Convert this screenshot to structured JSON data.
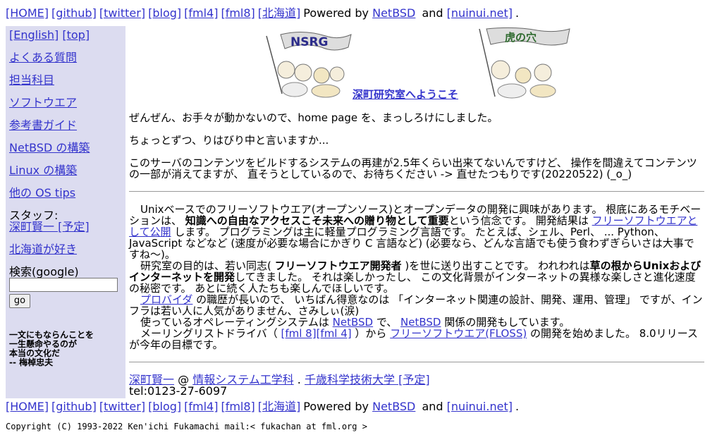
{
  "nav": {
    "home": "[HOME]",
    "github": "[github]",
    "twitter": "[twitter]",
    "blog": "[blog]",
    "fml4": "[fml4]",
    "fml8": "[fml8]",
    "hokkaido": "[北海道]",
    "powered_by": "Powered by",
    "netbsd": "NetBSD",
    "and": "and",
    "nuinui": "[nuinui.net]",
    "period": "."
  },
  "sidebar": {
    "english": "[English]",
    "top": "[top]",
    "faq": "よくある質問",
    "courses": "担当科目",
    "software": "ソフトウエア",
    "books": "参考書ガイド",
    "netbsd_build": "NetBSD の構築",
    "linux_build": "Linux の構築",
    "other_os": "他の OS tips",
    "staff_label": "スタッフ:",
    "staff_name": "深町賢一 [予定]",
    "hokkaido_love": "北海道が好き",
    "search_label": "検索(google)",
    "search_value": "",
    "go": "go",
    "motto": "一文にもならんことを\n一生懸命やるのが\n本当の文化だ\n-- 梅棹忠夫"
  },
  "main": {
    "banner_left_text": "NSRG",
    "banner_right_text": "虎の穴",
    "welcome": "深町研究室へようこそ",
    "para1": "ぜんぜん、お手々が動かないので、home page を、まっしろけにしました。",
    "para2": "ちょっとずつ、りはびり中と言いますか...",
    "para3": "このサーバのコンテンツをビルドするシステムの再建が2.5年くらい出来てないんですけど、 操作を間違えてコンテンツの一部が消えてますが、 直そうとしているので、お待ちください -> 直せたつもりです(20220522) (_o_)",
    "b1_a": "Unixベースでのフリーソフトウエア(オープンソース)とオープンデータの開発に興味があります。 根底にあるモチベーションは、 ",
    "b1_bold": "知識への自由なアクセスこそ未来への贈り物として重要",
    "b1_b": "という信念です。 開発結果は ",
    "b1_link": "フリーソフトウエアとして公開",
    "b1_c": " します。 プログラミングは主に軽量プログラミング言語です。 たとえば、シェル、Perl、 ... Python、 JavaScript などなど (速度が必要な場合にかぎり C 言語など) (必要なら、どんな言語でも使う食わずぎらいさは大事ですね〜)。",
    "b2_a": "研究室の目的は、若い同志( ",
    "b2_bold1": "フリーソフトウエア開発者",
    "b2_b": " )を世に送り出すことです。 われわれは",
    "b2_bold2": "草の根からUnixおよびインターネットを開発",
    "b2_c": "してきました。 それは楽しかったし、 この文化背景がインターネットの異様な楽しさと進化速度の秘密です。 あとに続く人たちも楽しんでほしいです。",
    "b3_link": "プロバイダ",
    "b3_a": " の職歴が長いので、 いちばん得意なのは 「インターネット関連の設計、開発、運用、管理」 ですが、インフラは若い人に人気がありません、さみしぃ(涙)",
    "b4_a": "使っているオペレーティングシステムは ",
    "b4_link1": "NetBSD",
    "b4_b": " で、 ",
    "b4_link2": "NetBSD",
    "b4_c": " 関係の開発もしています。",
    "b5_a": "メーリングリストドライバ（ ",
    "b5_link1": "[fml 8]",
    "b5_link2": "[fml 4]",
    "b5_b": " ）から ",
    "b5_link3": "フリーソフトウエア(FLOSS)",
    "b5_c": " の開発を始めました。 8.0リリースが今年の目標です。",
    "sig_name": "深町賢一",
    "sig_at": " @ ",
    "sig_dept": "情報システム工学科",
    "sig_dot": " . ",
    "sig_univ": "千歳科学技術大学 [予定]",
    "tel": "tel:0123-27-6097"
  },
  "footer": {
    "copyright": "Copyright (C) 1993-2022 Ken'ichi Fukamachi mail:< fukachan at fml.org >"
  },
  "colors": {
    "link": "#3333cc",
    "sidebar_bg": "#dcdcf0"
  }
}
